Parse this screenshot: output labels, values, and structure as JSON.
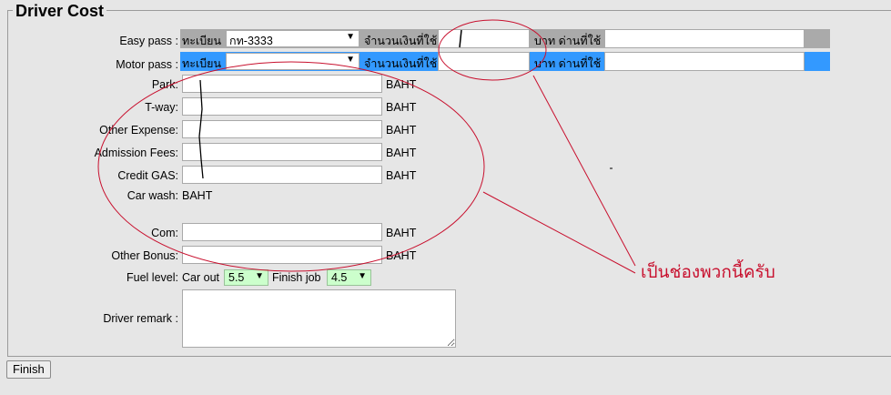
{
  "section": {
    "title": "Driver Cost"
  },
  "easy_pass": {
    "label": "Easy pass :",
    "plate_label": "ทะเบียน",
    "plate_value": "กท-3333",
    "amount_label": "จำนวนเงินที่ใช้",
    "toll_label": "บาท ด่านที่ใช้",
    "amount_value": "",
    "toll_value": ""
  },
  "motor_pass": {
    "label": "Motor pass :",
    "plate_label": "ทะเบียน",
    "plate_value": "",
    "amount_label": "จำนวนเงินที่ใช้",
    "toll_label": "บาท ด่านที่ใช้",
    "amount_value": "",
    "toll_value": ""
  },
  "fields": [
    {
      "label": "Park:",
      "unit": "BAHT",
      "value": ""
    },
    {
      "label": "T-way:",
      "unit": "BAHT",
      "value": ""
    },
    {
      "label": "Other Expense:",
      "unit": "BAHT",
      "value": ""
    },
    {
      "label": "Admission Fees:",
      "unit": "BAHT",
      "value": ""
    },
    {
      "label": "Credit GAS:",
      "unit": "BAHT",
      "value": ""
    }
  ],
  "car_wash": {
    "label": "Car wash:",
    "unit": "BAHT"
  },
  "com": {
    "label": "Com:",
    "unit": "BAHT",
    "value": ""
  },
  "other_bonus": {
    "label": "Other Bonus:",
    "unit": "BAHT",
    "value": ""
  },
  "fuel": {
    "label": "Fuel level:",
    "car_out_label": "Car out",
    "car_out_value": "5.5",
    "finish_label": "Finish job",
    "finish_value": "4.5"
  },
  "remark": {
    "label": "Driver remark :",
    "value": ""
  },
  "finish_button": "Finish",
  "annotation": {
    "text": "เป็นช่องพวกนี้ครับ",
    "color": "#c8102e"
  },
  "colors": {
    "easy_strip": "#aaaaaa",
    "motor_strip": "#3399ff",
    "fuel_select": "#ccffcc"
  }
}
